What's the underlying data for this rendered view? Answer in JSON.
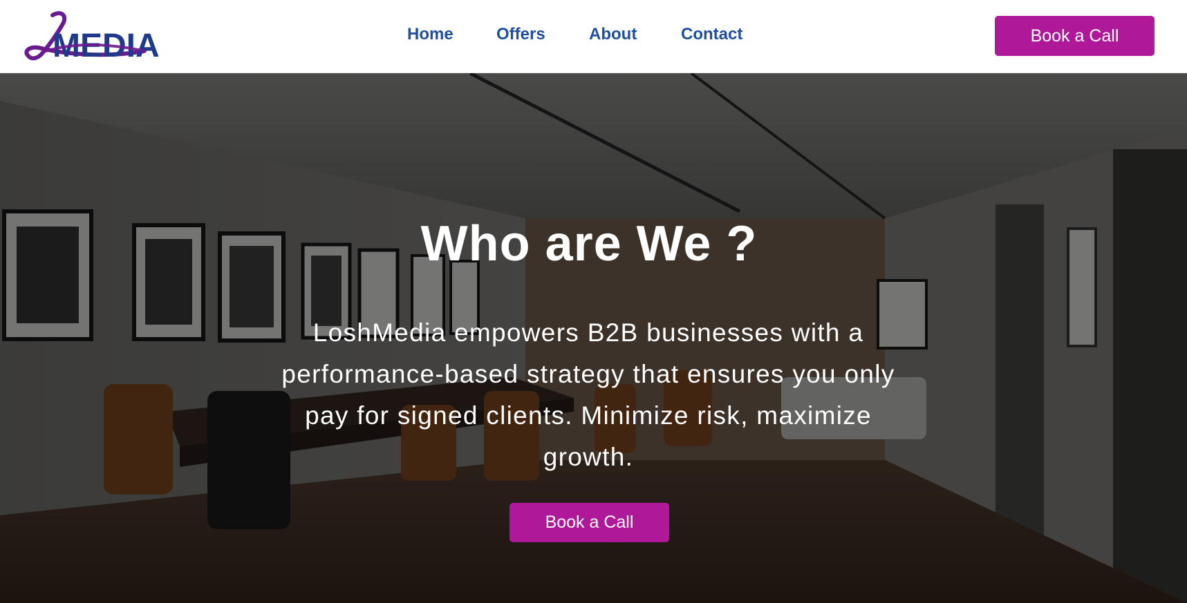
{
  "brand": {
    "logo_text": "MEDIA",
    "logo_initial": "L",
    "colors": {
      "logo_blue": "#1f3a8a",
      "logo_purple": "#6a1b8f",
      "nav_link": "#1f4fa0",
      "cta_background": "#b0189a",
      "cta_text": "#ffffff"
    }
  },
  "nav": {
    "items": [
      {
        "label": "Home"
      },
      {
        "label": "Offers"
      },
      {
        "label": "About"
      },
      {
        "label": "Contact"
      }
    ],
    "cta_label": "Book a Call"
  },
  "hero": {
    "title": "Who are We ?",
    "description": "LoshMedia empowers B2B businesses with a performance-based strategy that ensures you only pay for signed clients. Minimize risk, maximize growth.",
    "cta_label": "Book a Call",
    "background": "conference-room-photo"
  }
}
